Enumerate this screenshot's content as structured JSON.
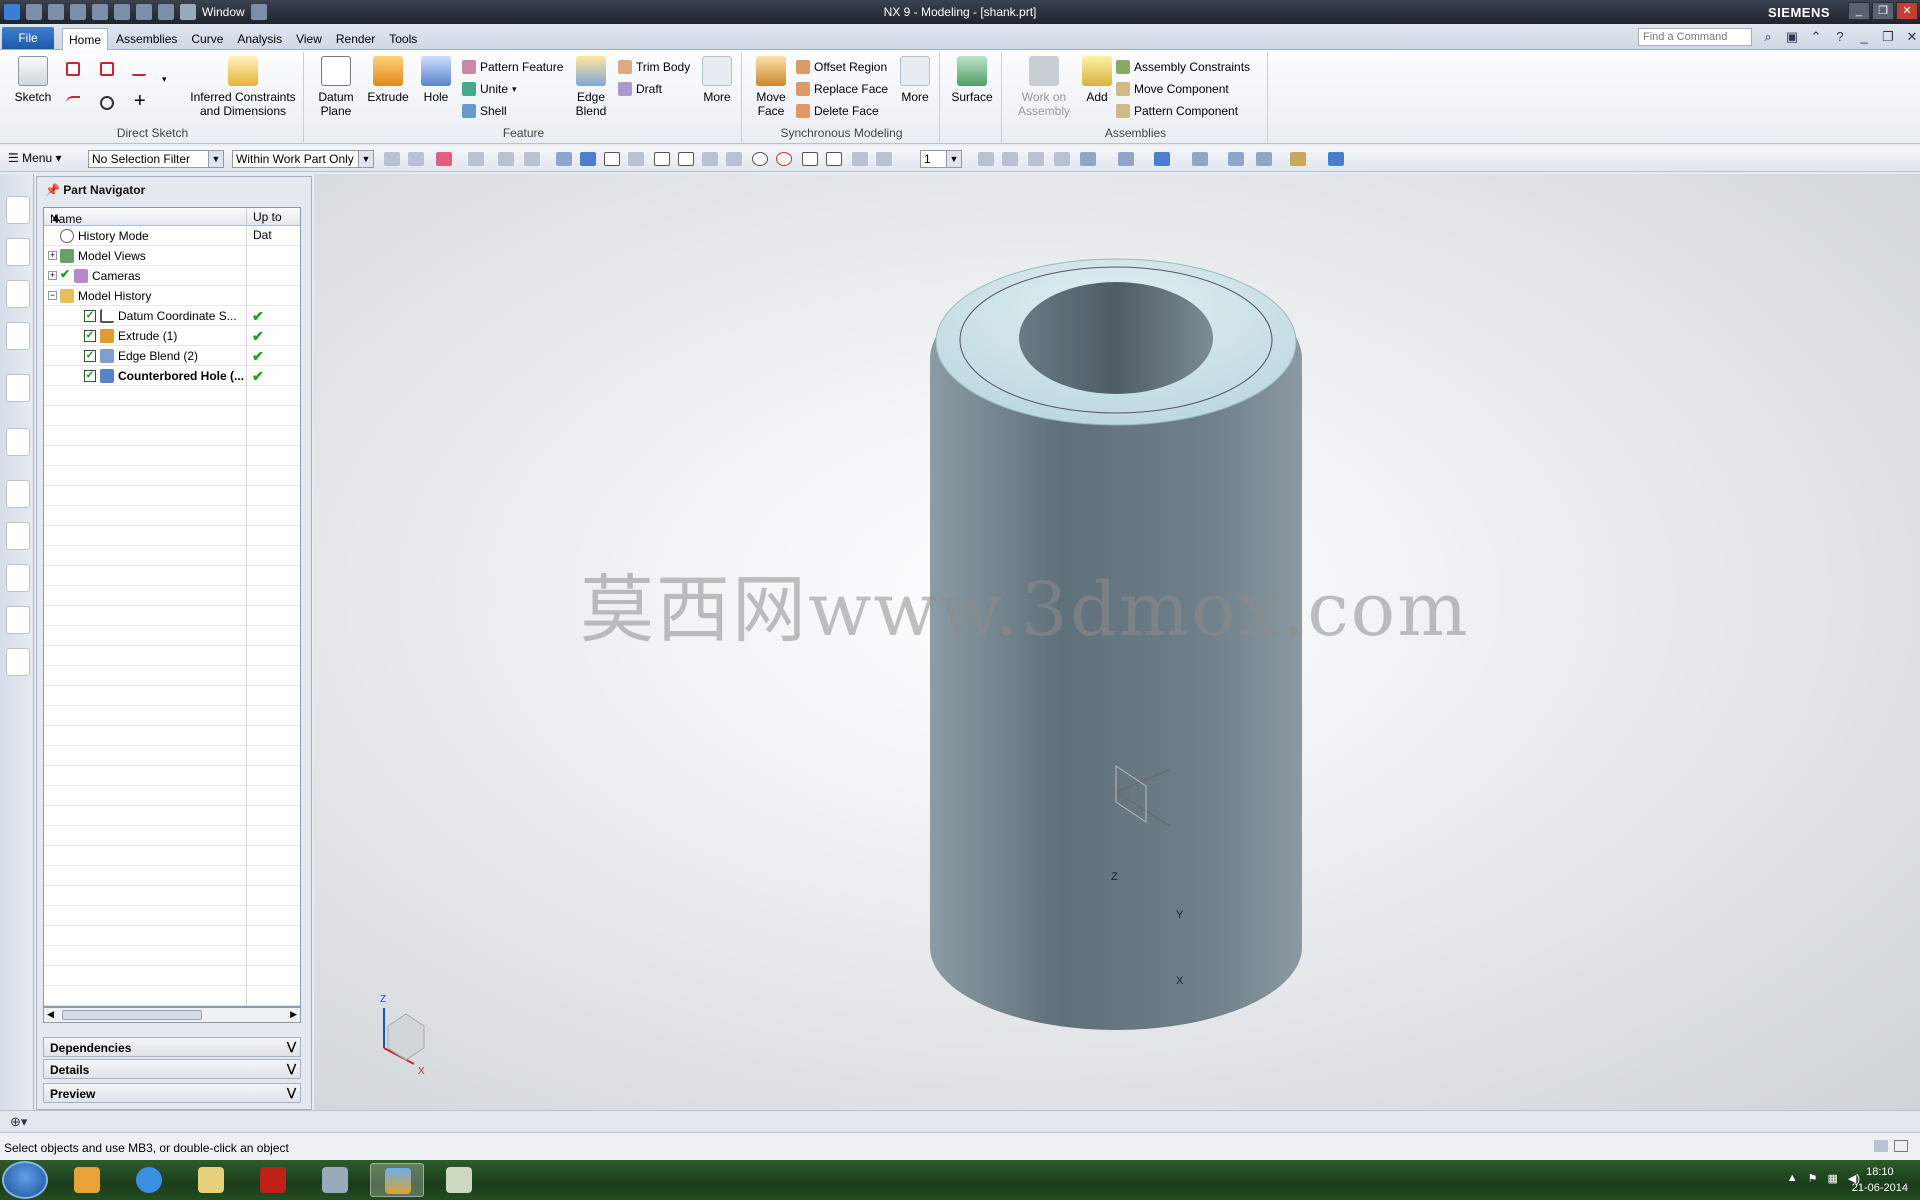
{
  "window": {
    "title": "NX 9 - Modeling - [shank.prt]",
    "brand": "SIEMENS",
    "quick_window_label": "Window"
  },
  "tabs": {
    "file": "File",
    "items": [
      "Home",
      "Assemblies",
      "Curve",
      "Analysis",
      "View",
      "Render",
      "Tools"
    ],
    "active": "Home"
  },
  "find_command": {
    "placeholder": "Find a Command"
  },
  "ribbon": {
    "direct_sketch": {
      "sketch": "Sketch",
      "inferred_1": "Inferred Constraints",
      "inferred_2": "and Dimensions",
      "group": "Direct Sketch"
    },
    "feature": {
      "datum_1": "Datum",
      "datum_2": "Plane",
      "extrude": "Extrude",
      "hole": "Hole",
      "pattern_feature": "Pattern Feature",
      "unite": "Unite",
      "shell": "Shell",
      "edge_blend_1": "Edge",
      "edge_blend_2": "Blend",
      "trim_body": "Trim Body",
      "draft": "Draft",
      "more": "More",
      "group": "Feature"
    },
    "sync": {
      "move_face_1": "Move",
      "move_face_2": "Face",
      "offset_region": "Offset Region",
      "replace_face": "Replace Face",
      "delete_face": "Delete Face",
      "more": "More",
      "group": "Synchronous Modeling"
    },
    "surface": {
      "label": "Surface"
    },
    "assemblies": {
      "work_1": "Work on",
      "work_2": "Assembly",
      "add": "Add",
      "assembly_constraints": "Assembly Constraints",
      "move_component": "Move Component",
      "pattern_component": "Pattern Component",
      "group": "Assemblies"
    }
  },
  "toolbar": {
    "menu": "Menu",
    "selection_filter": "No Selection Filter",
    "scope": "Within Work Part Only",
    "layer": "1"
  },
  "navigator": {
    "title": "Part Navigator",
    "columns": [
      "Name",
      "Up to Dat"
    ],
    "rows": [
      {
        "label": "History Mode"
      },
      {
        "label": "Model Views"
      },
      {
        "label": "Cameras"
      },
      {
        "label": "Model History"
      },
      {
        "label": "Datum Coordinate S..."
      },
      {
        "label": "Extrude (1)"
      },
      {
        "label": "Edge Blend (2)"
      },
      {
        "label": "Counterbored Hole (..."
      }
    ],
    "panels": [
      "Dependencies",
      "Details",
      "Preview"
    ]
  },
  "viewport": {
    "watermark": "莫西网www.3dmox.com",
    "axes": {
      "z": "Z",
      "y": "Y",
      "x": "X"
    }
  },
  "status": {
    "message": "Select objects and use MB3, or double-click an object"
  },
  "taskbar": {
    "time": "18:10",
    "date": "21-06-2014"
  },
  "colors": {
    "model_top": "#cde3e9",
    "model_side": "#6d7e85",
    "accent": "#1f5aa8"
  }
}
